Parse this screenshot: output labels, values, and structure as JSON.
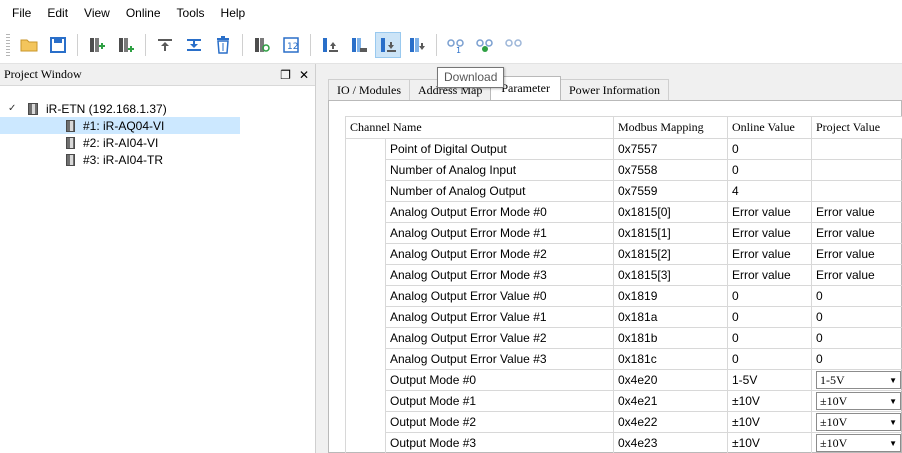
{
  "menu": [
    "File",
    "Edit",
    "View",
    "Online",
    "Tools",
    "Help"
  ],
  "toolbar": {
    "icons": [
      "open-folder-icon",
      "save-icon",
      "add-module-icon",
      "add-module-2-icon",
      "move-up-icon",
      "move-down-icon",
      "delete-icon",
      "scan-icon",
      "io-map-icon",
      "upload-icon",
      "compare-icon",
      "download-icon",
      "download-all-icon",
      "connect-icon",
      "disconnect-icon",
      "link-icon"
    ],
    "tooltip": "Download"
  },
  "project_window": {
    "title": "Project Window",
    "pin": "❐",
    "close": "✕",
    "root": "iR-ETN (192.168.1.37)",
    "children": [
      "#1: iR-AQ04-VI",
      "#2: iR-AI04-VI",
      "#3: iR-AI04-TR"
    ],
    "selected_index": 0
  },
  "tabs": [
    "IO / Modules",
    "Address Map",
    "Parameter",
    "Power Information"
  ],
  "active_tab": "Parameter",
  "table": {
    "headers": [
      "Channel Name",
      "Modbus Mapping",
      "Online Value",
      "Project Value"
    ],
    "rows": [
      {
        "name": "Point of Digital Output",
        "map": "0x7557",
        "online": "0",
        "project": ""
      },
      {
        "name": "Number of Analog Input",
        "map": "0x7558",
        "online": "0",
        "project": ""
      },
      {
        "name": "Number of Analog Output",
        "map": "0x7559",
        "online": "4",
        "project": ""
      },
      {
        "name": "Analog Output Error Mode #0",
        "map": "0x1815[0]",
        "online": "Error value",
        "project": "Error value"
      },
      {
        "name": "Analog Output Error Mode #1",
        "map": "0x1815[1]",
        "online": "Error value",
        "project": "Error value"
      },
      {
        "name": "Analog Output Error Mode #2",
        "map": "0x1815[2]",
        "online": "Error value",
        "project": "Error value"
      },
      {
        "name": "Analog Output Error Mode #3",
        "map": "0x1815[3]",
        "online": "Error value",
        "project": "Error value"
      },
      {
        "name": "Analog Output Error Value #0",
        "map": "0x1819",
        "online": "0",
        "project": "0"
      },
      {
        "name": "Analog Output Error Value #1",
        "map": "0x181a",
        "online": "0",
        "project": "0"
      },
      {
        "name": "Analog Output Error Value #2",
        "map": "0x181b",
        "online": "0",
        "project": "0"
      },
      {
        "name": "Analog Output Error Value #3",
        "map": "0x181c",
        "online": "0",
        "project": "0"
      },
      {
        "name": "Output Mode #0",
        "map": "0x4e20",
        "online": "1-5V",
        "project": "1-5V",
        "combo": true
      },
      {
        "name": "Output Mode #1",
        "map": "0x4e21",
        "online": "±10V",
        "project": "±10V",
        "combo": true
      },
      {
        "name": "Output Mode #2",
        "map": "0x4e22",
        "online": "±10V",
        "project": "±10V",
        "combo": true
      },
      {
        "name": "Output Mode #3",
        "map": "0x4e23",
        "online": "±10V",
        "project": "±10V",
        "combo": true
      }
    ]
  }
}
